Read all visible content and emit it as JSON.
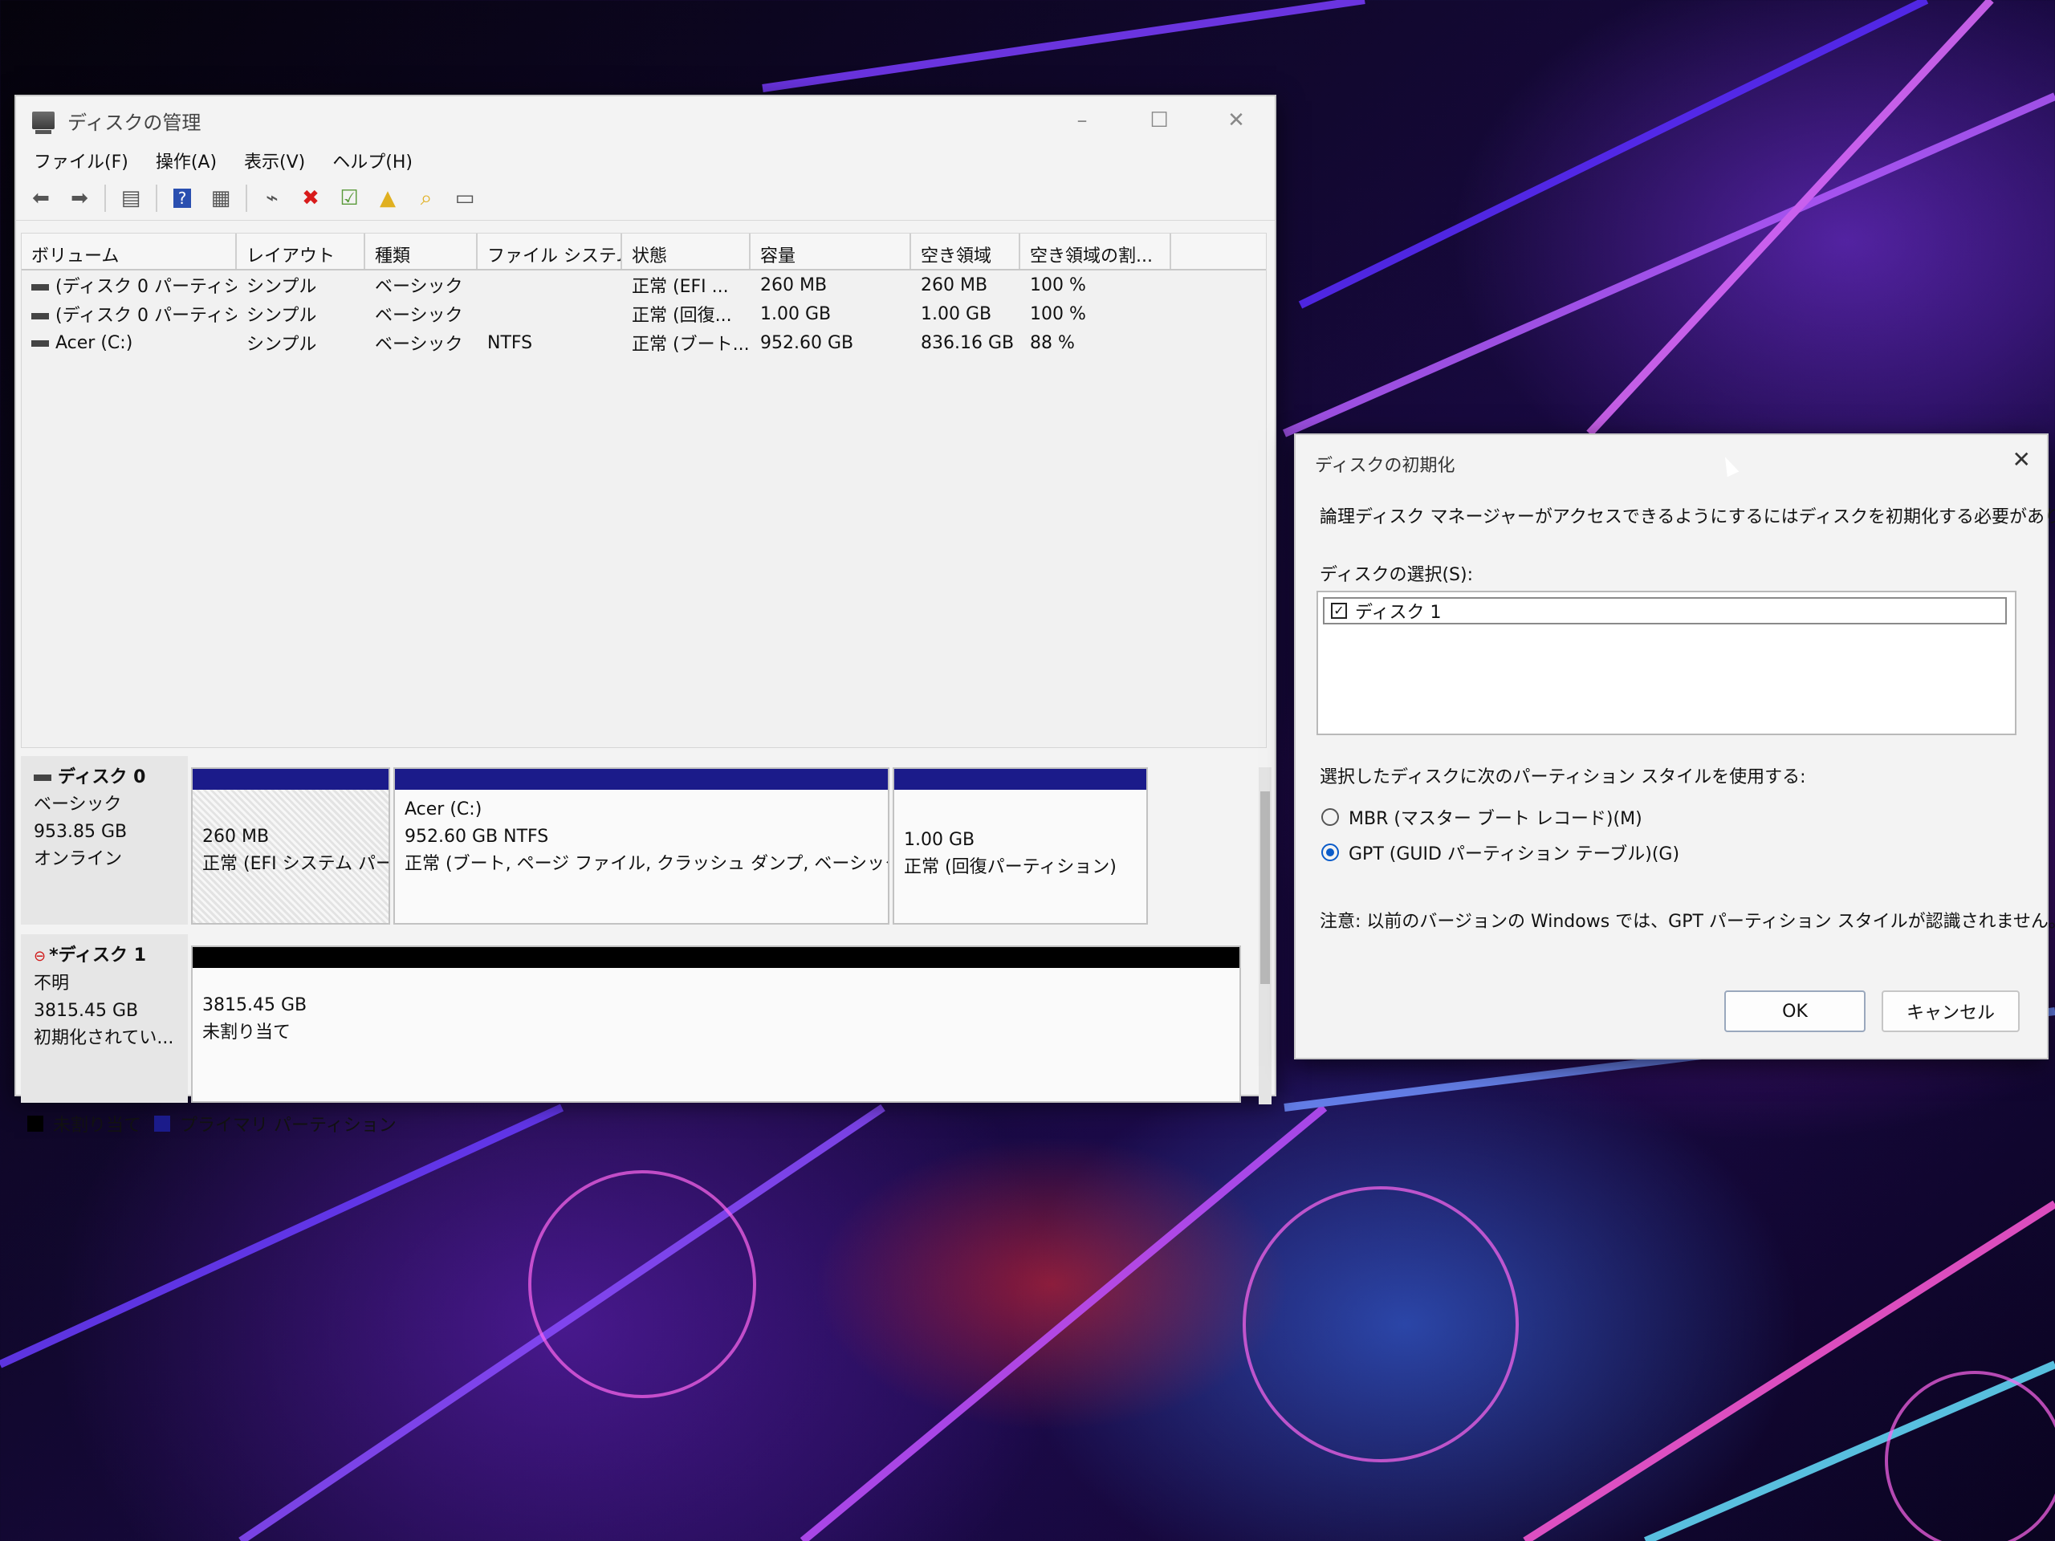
{
  "colors": {
    "primary_partition": "#1b1b8a",
    "unallocated": "#000000",
    "accent": "#0a5bc9"
  },
  "disk_mgmt": {
    "title": "ディスクの管理",
    "menu": [
      "ファイル(F)",
      "操作(A)",
      "表示(V)",
      "ヘルプ(H)"
    ],
    "toolbar_icons": [
      "back-arrow-icon",
      "forward-arrow-icon",
      "console-tree-icon",
      "help-icon",
      "properties-icon",
      "connect-icon",
      "delete-icon",
      "check-icon",
      "up-folder-icon",
      "search-folder-icon",
      "view-icon"
    ],
    "columns": [
      "ボリューム",
      "レイアウト",
      "種類",
      "ファイル システム",
      "状態",
      "容量",
      "空き領域",
      "空き領域の割..."
    ],
    "volumes": [
      {
        "name": "(ディスク 0 パーティショ...",
        "layout": "シンプル",
        "type": "ベーシック",
        "fs": "",
        "status": "正常 (EFI ...",
        "capacity": "260 MB",
        "free": "260 MB",
        "pct": "100 %"
      },
      {
        "name": "(ディスク 0 パーティショ...",
        "layout": "シンプル",
        "type": "ベーシック",
        "fs": "",
        "status": "正常 (回復...",
        "capacity": "1.00 GB",
        "free": "1.00 GB",
        "pct": "100 %"
      },
      {
        "name": "Acer (C:)",
        "layout": "シンプル",
        "type": "ベーシック",
        "fs": "NTFS",
        "status": "正常 (ブート...",
        "capacity": "952.60 GB",
        "free": "836.16 GB",
        "pct": "88 %"
      }
    ],
    "disk0": {
      "name": "ディスク 0",
      "type": "ベーシック",
      "size": "953.85 GB",
      "state": "オンライン",
      "partitions": [
        {
          "line1": "260 MB",
          "line2": "正常 (EFI システム パー"
        },
        {
          "line0": "Acer (C:)",
          "line1": "952.60 GB NTFS",
          "line2": "正常 (ブート, ページ ファイル, クラッシュ ダンプ, ベーシック データ パ"
        },
        {
          "line1": "1.00 GB",
          "line2": "正常 (回復パーティション)"
        }
      ]
    },
    "disk1": {
      "name": "*ディスク 1",
      "type": "不明",
      "size": "3815.45 GB",
      "state": "初期化されてい...",
      "partition": {
        "line1": "3815.45 GB",
        "line2": "未割り当て"
      }
    },
    "legend": [
      "未割り当て",
      "プライマリ パーティション"
    ]
  },
  "dialog": {
    "title": "ディスクの初期化",
    "description": "論理ディスク マネージャーがアクセスできるようにするにはディスクを初期化する必要があります。",
    "select_label": "ディスクの選択(S):",
    "disk_item": "ディスク 1",
    "style_label": "選択したディスクに次のパーティション スタイルを使用する:",
    "mbr": "MBR (マスター ブート レコード)(M)",
    "gpt": "GPT (GUID パーティション テーブル)(G)",
    "note": "注意: 以前のバージョンの Windows では、GPT パーティション スタイルが認識されません。",
    "ok": "OK",
    "cancel": "キャンセル"
  }
}
